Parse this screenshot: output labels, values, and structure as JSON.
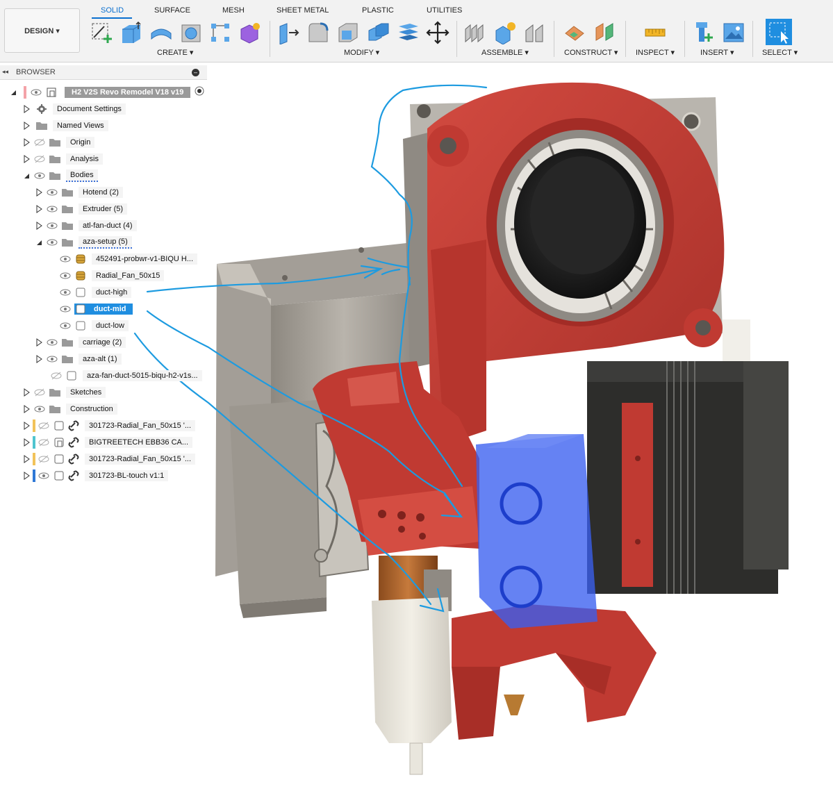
{
  "workspace": {
    "design_label": "DESIGN ▾"
  },
  "tabs": [
    "SOLID",
    "SURFACE",
    "MESH",
    "SHEET METAL",
    "PLASTIC",
    "UTILITIES"
  ],
  "groups": {
    "create": "CREATE ▾",
    "modify": "MODIFY ▾",
    "assemble": "ASSEMBLE ▾",
    "construct": "CONSTRUCT ▾",
    "inspect": "INSPECT ▾",
    "insert": "INSERT ▾",
    "select": "SELECT ▾"
  },
  "browser": {
    "title": "BROWSER",
    "root": "H2 V2S Revo Remodel V18 v19",
    "items": {
      "document_settings": "Document Settings",
      "named_views": "Named Views",
      "origin": "Origin",
      "analysis": "Analysis",
      "bodies": "Bodies",
      "hotend": "Hotend (2)",
      "extruder": "Extruder (5)",
      "atl_fan_duct": "atl-fan-duct (4)",
      "aza_setup": "aza-setup (5)",
      "probwr": "452491-probwr-v1-BIQU H...",
      "radial_fan": "Radial_Fan_50x15",
      "duct_high": "duct-high",
      "duct_mid": "duct-mid",
      "duct_low": "duct-low",
      "carriage": "carriage (2)",
      "aza_alt": "aza-alt (1)",
      "aza_fan_duct": "aza-fan-duct-5015-biqu-h2-v1s...",
      "sketches": "Sketches",
      "construction": "Construction",
      "comp1": "301723-Radial_Fan_50x15 '...",
      "comp2": "BIGTREETECH EBB36 CA...",
      "comp3": "301723-Radial_Fan_50x15 '...",
      "comp4": "301723-BL-touch v1:1"
    }
  },
  "colors": {
    "accent": "#0a6fcf",
    "selection": "#1f8ee0",
    "part_red": "#c03a32",
    "metal_grey": "#a8a39b",
    "blue_ghost": "#3a5ff0",
    "annotation": "#1d9be0",
    "tab_yellow": "#f2c35a",
    "tab_teal": "#4fc4cf",
    "tab_blue": "#2f78d6"
  }
}
